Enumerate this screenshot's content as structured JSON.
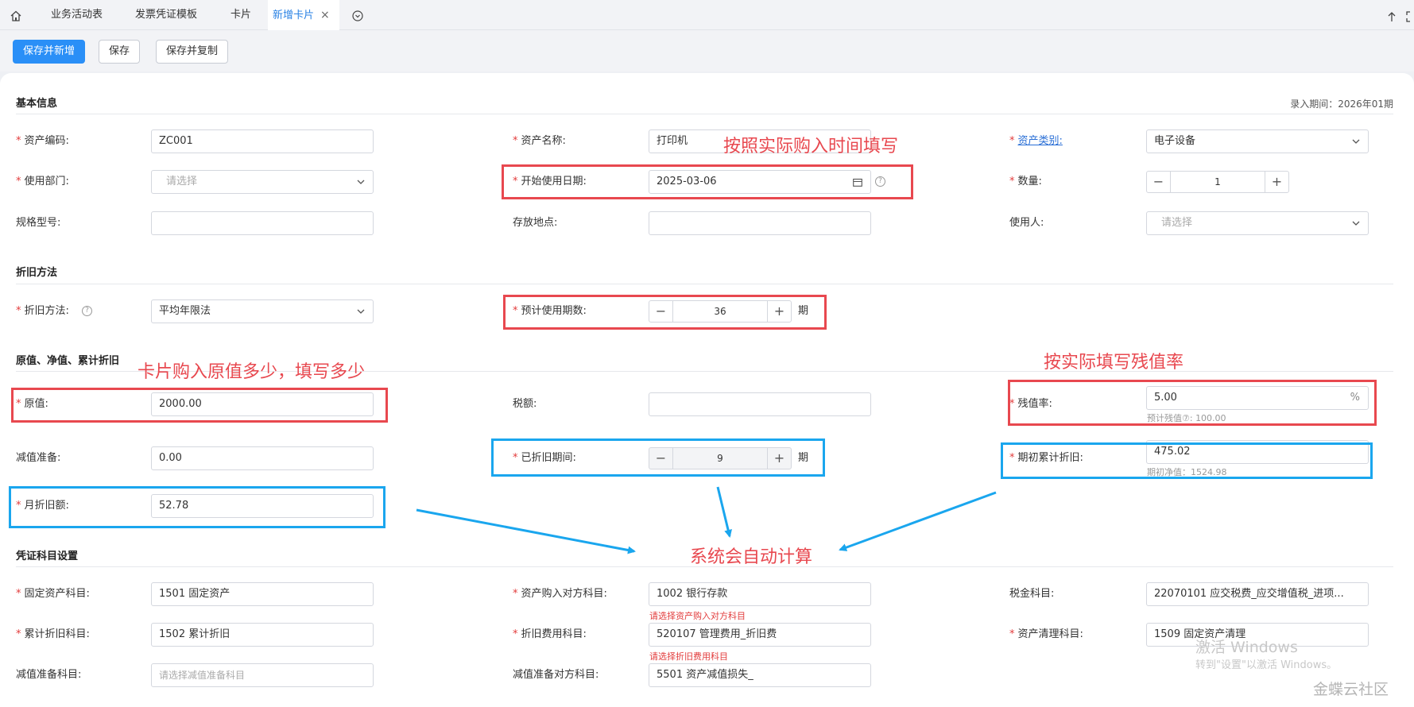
{
  "tabs": [
    {
      "label": "业务活动表"
    },
    {
      "label": "发票凭证模板"
    },
    {
      "label": "卡片"
    },
    {
      "label": "新增卡片"
    }
  ],
  "toolbar": {
    "save_new": "保存并新增",
    "save": "保存",
    "save_copy": "保存并复制"
  },
  "period": "录入期间：2026年01期",
  "sections": {
    "basic": "基本信息",
    "depr": "折旧方法",
    "value": "原值、净值、累计折旧",
    "voucher": "凭证科目设置"
  },
  "fields": {
    "asset_code": {
      "label": "资产编码:",
      "value": "ZC001"
    },
    "asset_name": {
      "label": "资产名称:",
      "value": "打印机"
    },
    "asset_cat": {
      "label": "资产类别:",
      "value": "电子设备"
    },
    "dept": {
      "label": "使用部门:",
      "placeholder": "请选择"
    },
    "start_date": {
      "label": "开始使用日期:",
      "value": "2025-03-06"
    },
    "qty": {
      "label": "数量:",
      "value": "1"
    },
    "spec": {
      "label": "规格型号:",
      "value": ""
    },
    "location": {
      "label": "存放地点:",
      "value": ""
    },
    "user": {
      "label": "使用人:",
      "placeholder": "请选择"
    },
    "depr_method": {
      "label": "折旧方法:",
      "value": "平均年限法"
    },
    "life": {
      "label": "预计使用期数:",
      "value": "36",
      "unit": "期"
    },
    "orig": {
      "label": "原值:",
      "value": "2000.00"
    },
    "tax": {
      "label": "税额:",
      "value": ""
    },
    "salvage_rate": {
      "label": "残值率:",
      "value": "5.00",
      "unit": "%",
      "hint": "预计残值⑦: 100.00"
    },
    "impair": {
      "label": "减值准备:",
      "value": "0.00"
    },
    "depr_periods": {
      "label": "已折旧期间:",
      "value": "9",
      "unit": "期"
    },
    "acc_depr": {
      "label": "期初累计折旧:",
      "value": "475.02",
      "hint": "期初净值：1524.98"
    },
    "monthly": {
      "label": "月折旧额:",
      "value": "52.78"
    },
    "fa_acct": {
      "label": "固定资产科目:",
      "value": "1501 固定资产"
    },
    "purchase_acct": {
      "label": "资产购入对方科目:",
      "value": "1002 银行存款",
      "error": "请选择资产购入对方科目"
    },
    "tax_acct": {
      "label": "税金科目:",
      "value": "22070101 应交税费_应交增值税_进项..."
    },
    "accdepr_acct": {
      "label": "累计折旧科目:",
      "value": "1502 累计折旧"
    },
    "deprexp_acct": {
      "label": "折旧费用科目:",
      "value": "520107 管理费用_折旧费",
      "error": "请选择折旧费用科目"
    },
    "clear_acct": {
      "label": "资产清理科目:",
      "value": "1509 固定资产清理"
    },
    "impair_acct": {
      "label": "减值准备科目:",
      "placeholder": "请选择减值准备科目"
    },
    "impair_contra": {
      "label": "减值准备对方科目:",
      "value": "5501 资产减值损失_"
    }
  },
  "annotations": {
    "date": "按照实际购入时间填写",
    "orig": "卡片购入原值多少，填写多少",
    "salvage": "按实际填写残值率",
    "auto": "系统会自动计算"
  },
  "watermark": {
    "line1": "激活 Windows",
    "line2": "转到\"设置\"以激活 Windows。"
  },
  "logo": "金蝶云社区"
}
